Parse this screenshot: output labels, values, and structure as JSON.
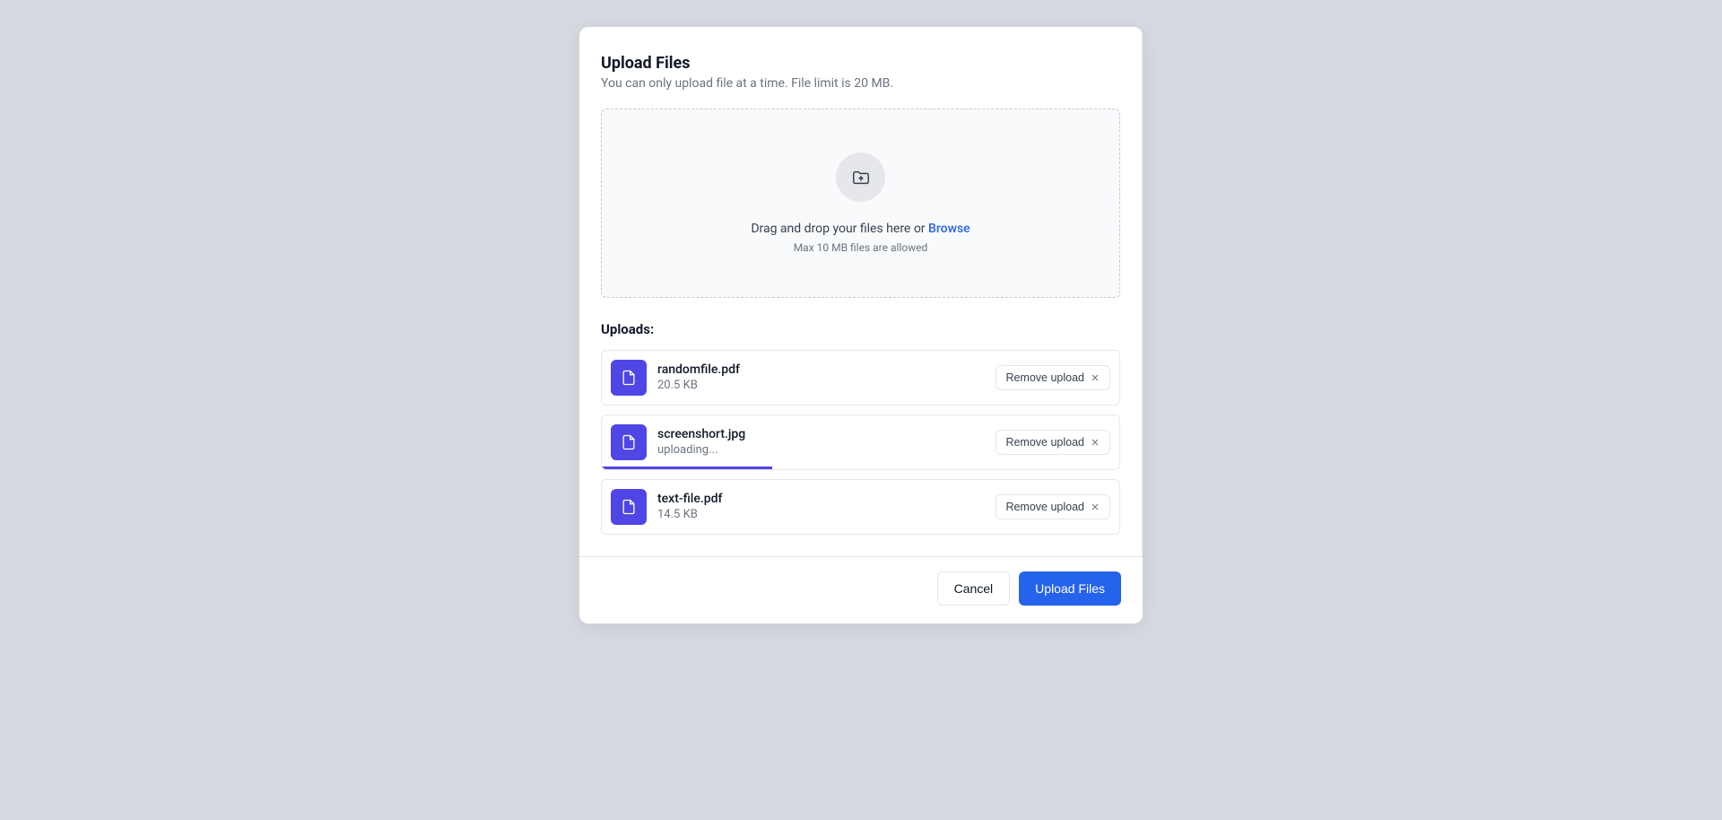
{
  "header": {
    "title": "Upload Files",
    "subtitle": "You can only upload file at a time. File limit is 20 MB."
  },
  "dropzone": {
    "text_prefix": "Drag and drop your files here or ",
    "browse": "Browse",
    "hint": "Max 10 MB files are allowed"
  },
  "uploads": {
    "title": "Uploads:",
    "remove_label": "Remove upload",
    "items": [
      {
        "name": "randomfile.pdf",
        "meta": "20.5 KB",
        "uploading": false,
        "progress": 0
      },
      {
        "name": "screenshort.jpg",
        "meta": "uploading...",
        "uploading": true,
        "progress": 33
      },
      {
        "name": "text-file.pdf",
        "meta": "14.5 KB",
        "uploading": false,
        "progress": 0
      }
    ]
  },
  "footer": {
    "cancel": "Cancel",
    "upload": "Upload Files"
  }
}
